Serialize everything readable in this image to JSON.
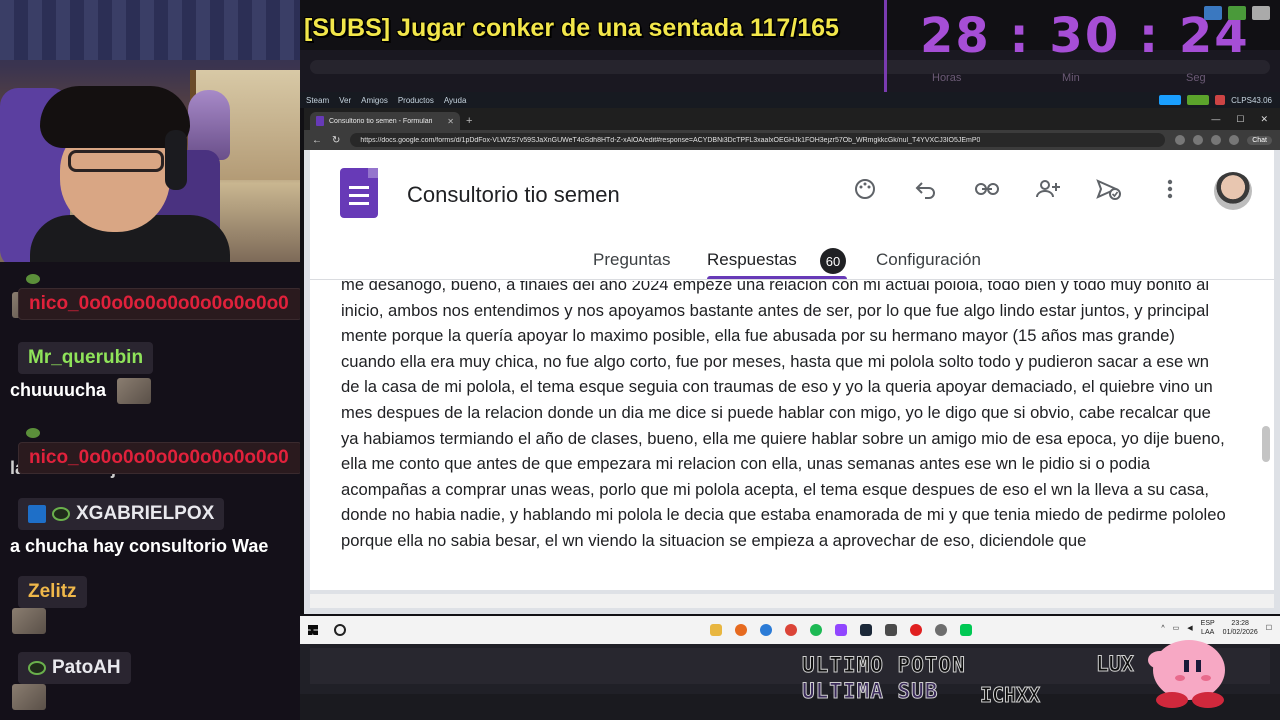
{
  "overlay": {
    "stream_title": "[SUBS] Jugar conker de una sentada 117/165",
    "timer": "28 : 30 : 24",
    "timer_labels": [
      "Horas",
      "Min",
      "Seg"
    ],
    "goal_line1": "ULTIMO POTON",
    "goal_line2": "ULTIMA SUB",
    "goal_name": "ICHXX",
    "goal_side": "LUX"
  },
  "chat": {
    "messages": [
      {
        "user": "nico_0o0o0o0o0o0o0o0o0o0",
        "text": "",
        "user_color": "#e0213b"
      },
      {
        "user": "Mr_querubin",
        "text": "chuuuucha",
        "user_color": "#8fe35a"
      },
      {
        "user": "nico_0o0o0o0o0o0o0o0o0o0",
        "text": "la weá del ojo",
        "user_color": "#e0213b"
      },
      {
        "user": "XGABRIELPOX",
        "text": "a chucha hay consultorio Wae",
        "user_color": "#e9e9ee"
      },
      {
        "user": "Zelitz",
        "text": "",
        "user_color": "#f0b84a"
      },
      {
        "user": "PatoAH",
        "text": "",
        "user_color": "#e9e9ee"
      }
    ]
  },
  "steam": {
    "menu": [
      "Steam",
      "Ver",
      "Amigos",
      "Productos",
      "Ayuda"
    ],
    "user": "CLPS43.06"
  },
  "browser": {
    "tab_title": "Consultorio tio semen - Formulari",
    "url": "https://docs.google.com/forms/d/1pDdFox-VLWZS7v59SJaXnGUWeT4oSdh8HTd-Z-xAlOA/edit#response=ACYDBNi3DcTPFL3xaalxOEGHJk1FOH3ejzr57Ob_WRmgkkcGk/nul_T4YVXCJ3IO5JEmP0",
    "chat_label": "Chat"
  },
  "form": {
    "title": "Consultorio tio semen",
    "tabs": [
      "Preguntas",
      "Respuestas",
      "Configuración"
    ],
    "responses_count": "60",
    "response_text": "me desahogo, bueno, a finales del año 2024 empeze una relacion con mi actual polola, todo bien y todo muy bonito al inicio, ambos nos entendimos y nos apoyamos bastante antes de ser, por lo que fue algo lindo estar juntos, y principal mente porque la quería apoyar lo maximo posible, ella fue abusada por su hermano mayor (15 años mas grande) cuando ella era muy chica, no fue algo corto, fue por meses, hasta que mi polola solto todo y pudieron sacar a ese wn de la casa de mi polola, el tema esque seguia con traumas de eso y yo la queria apoyar demaciado, el quiebre vino un mes despues de la relacion donde un dia me dice si puede hablar con migo, yo le digo que si obvio, cabe recalcar que ya habiamos termiando el año de clases, bueno, ella me quiere hablar sobre un amigo mio de esa epoca, yo dije bueno, ella me conto que antes de que empezara mi relacion con ella, unas semanas antes ese wn le pidio si o podia acompañas a comprar unas weas, porlo que mi polola acepta, el tema esque despues de eso el wn la lleva a su casa, donde no habia nadie, y hablando mi polola le decia que estaba enamorada de mi y que tenia miedo de pedirme pololeo porque ella no sabia besar, el wn viendo la situacion se empieza a aprovechar de eso, diciendole que"
  },
  "taskbar": {
    "lang": "ESP",
    "lang2": "LAA",
    "time": "23:28",
    "date": "01/02/2026"
  },
  "colors": {
    "title_yellow": "#f2e64a",
    "timer_purple": "#a64ed6",
    "forms_purple": "#673ab7"
  }
}
